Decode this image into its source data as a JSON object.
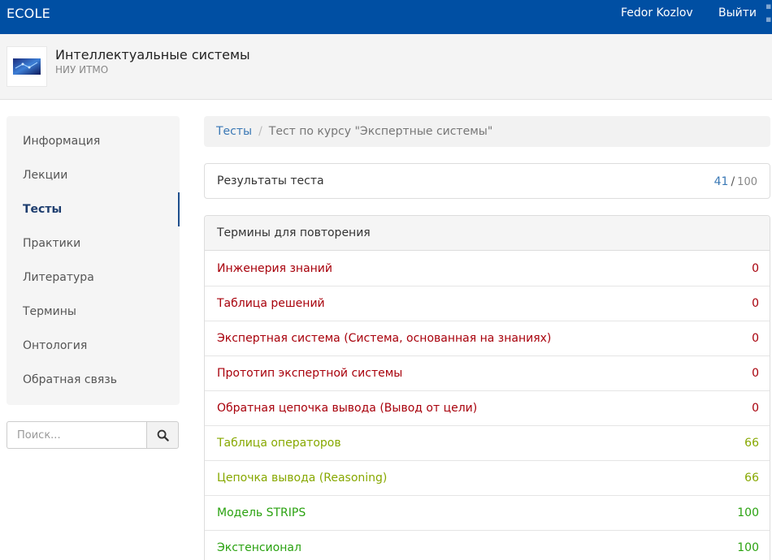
{
  "navbar": {
    "brand": "ECOLE",
    "user": "Fedor Kozlov",
    "logout": "Выйти"
  },
  "course": {
    "title": "Интеллектуальные системы",
    "org": "НИУ ИТМО"
  },
  "sidebar": {
    "items": [
      {
        "label": "Информация"
      },
      {
        "label": "Лекции"
      },
      {
        "label": "Тесты"
      },
      {
        "label": "Практики"
      },
      {
        "label": "Литература"
      },
      {
        "label": "Термины"
      },
      {
        "label": "Онтология"
      },
      {
        "label": "Обратная связь"
      }
    ],
    "active_index": 2
  },
  "search": {
    "placeholder": "Поиск..."
  },
  "breadcrumb": {
    "link": "Тесты",
    "separator": "/",
    "current": "Тест по курсу \"Экспертные системы\""
  },
  "result": {
    "label": "Результаты теста",
    "score": "41",
    "separator": "/",
    "max": "100"
  },
  "terms": {
    "title": "Термины для повторения",
    "rows": [
      {
        "name": "Инженерия знаний",
        "score": "0",
        "status": "low"
      },
      {
        "name": "Таблица решений",
        "score": "0",
        "status": "low"
      },
      {
        "name": "Экспертная система (Система, основанная на знаниях)",
        "score": "0",
        "status": "low"
      },
      {
        "name": "Прототип экспертной системы",
        "score": "0",
        "status": "low"
      },
      {
        "name": "Обратная цепочка вывода (Вывод от цели)",
        "score": "0",
        "status": "low"
      },
      {
        "name": "Таблица операторов",
        "score": "66",
        "status": "mid"
      },
      {
        "name": "Цепочка вывода (Reasoning)",
        "score": "66",
        "status": "mid"
      },
      {
        "name": "Модель STRIPS",
        "score": "100",
        "status": "high"
      },
      {
        "name": "Экстенсионал",
        "score": "100",
        "status": "high"
      }
    ]
  },
  "colors": {
    "navbar": "#004fa3",
    "link": "#3a78b5",
    "low": "#a8000b",
    "mid": "#87a800",
    "high": "#2aa210"
  },
  "icons": {
    "search_button": "search-icon",
    "course_logo": "course-logo-image"
  }
}
